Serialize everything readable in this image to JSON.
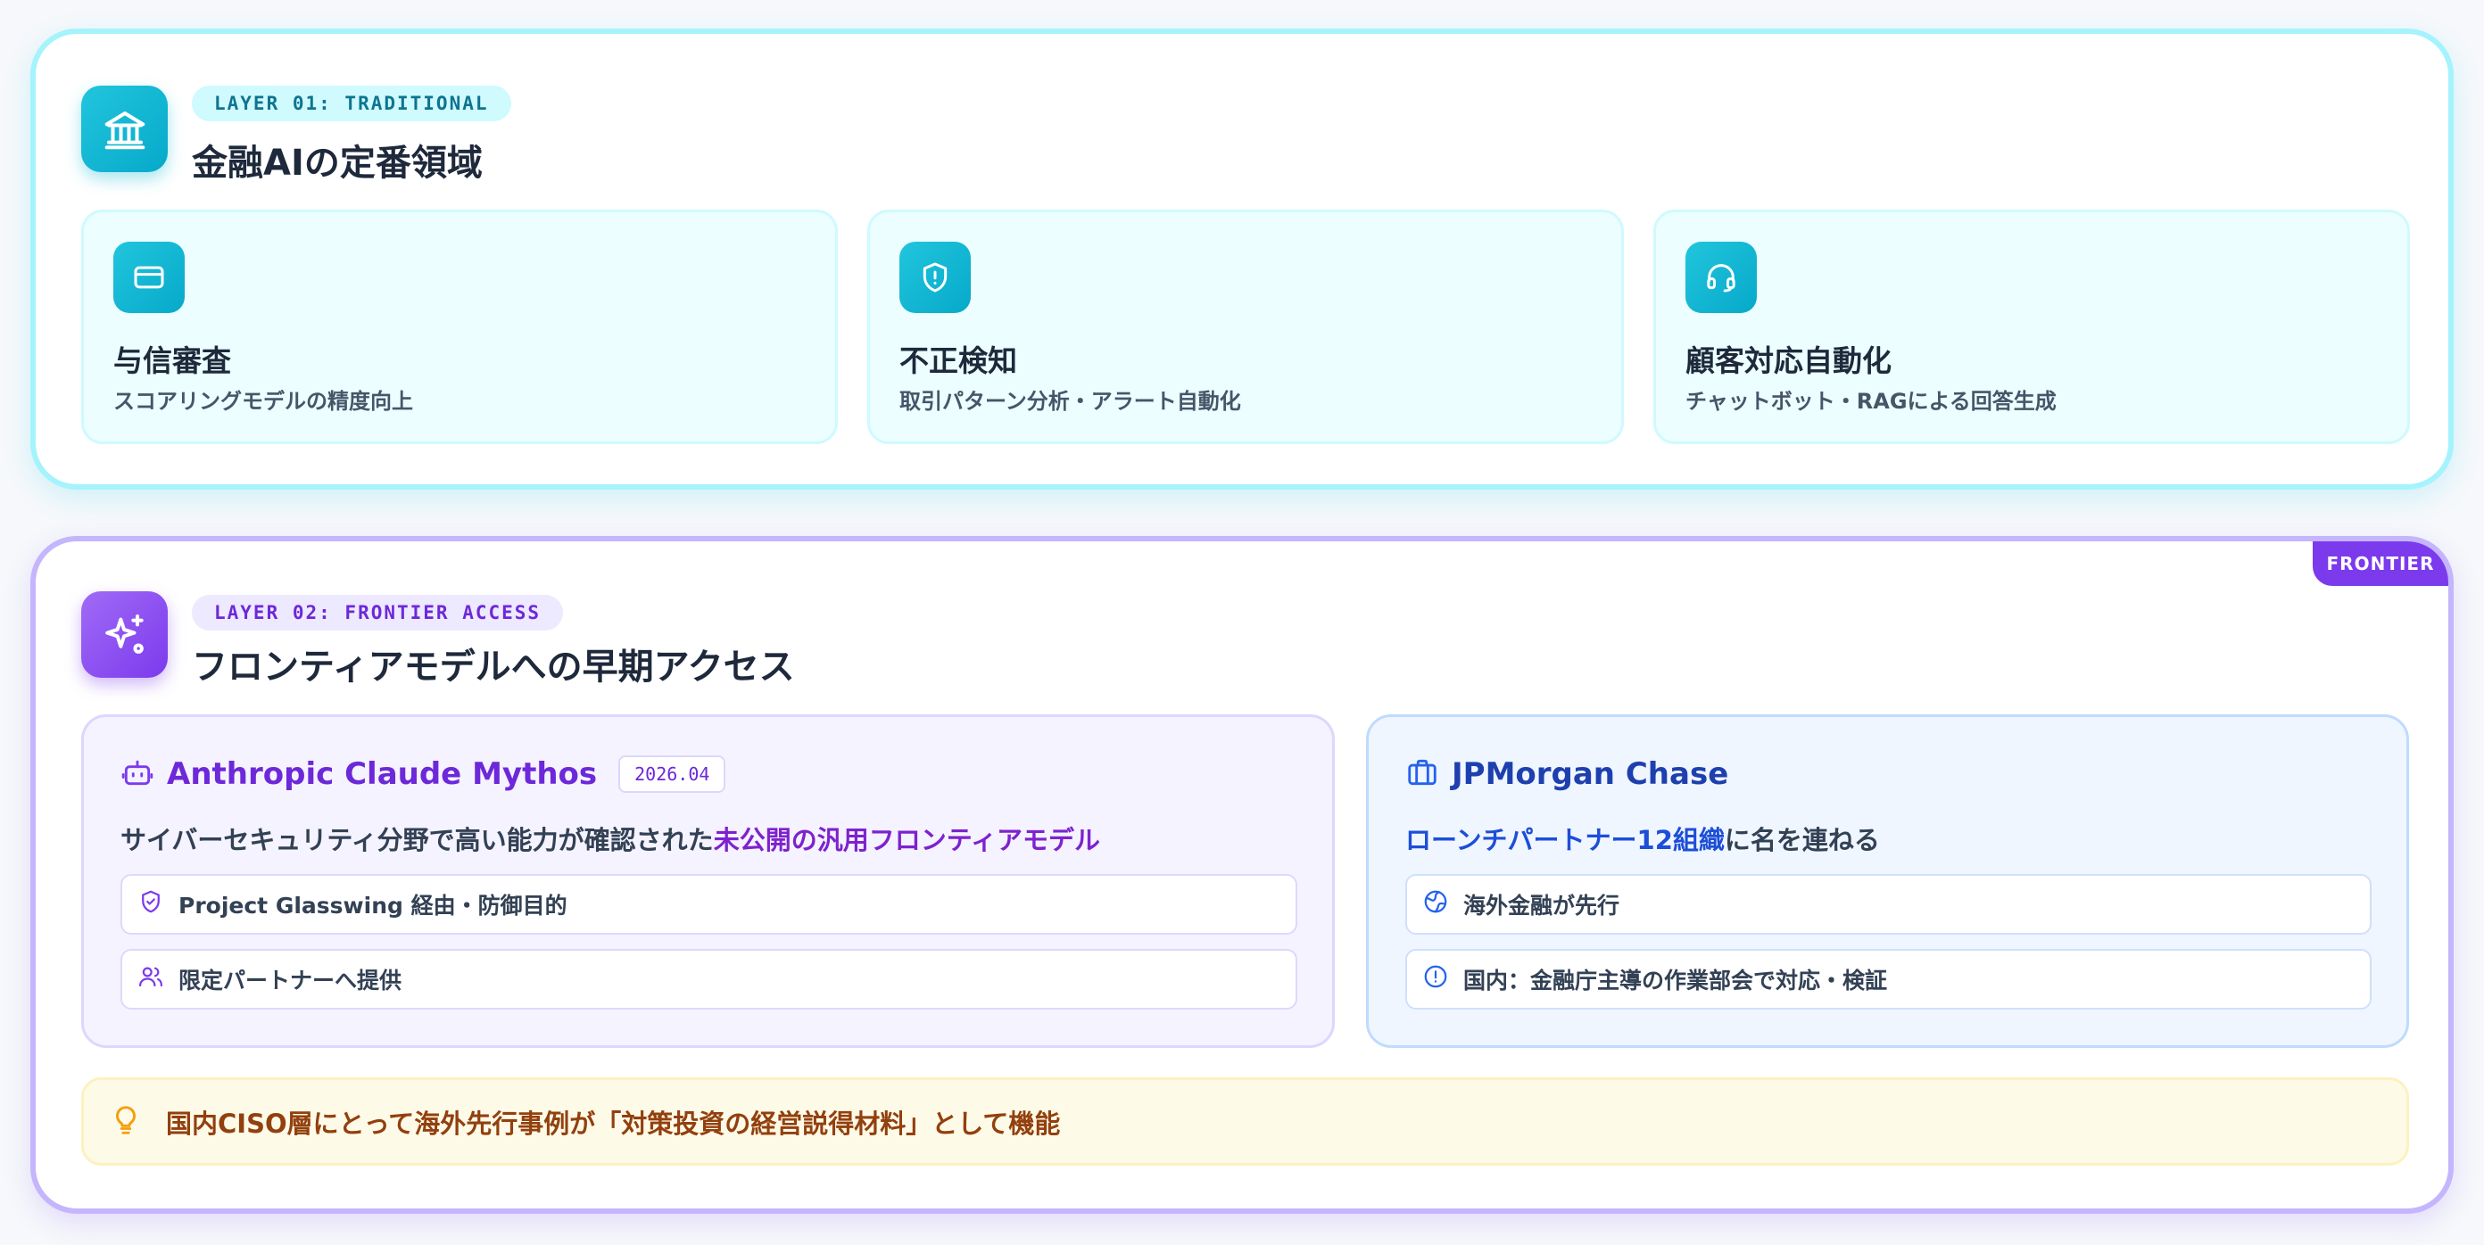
{
  "layer1": {
    "tag": "LAYER 01: TRADITIONAL",
    "title": "金融AIの定番領域",
    "icon": "bank-icon",
    "accent": "#06b6d4",
    "cards": [
      {
        "icon": "credit-card-icon",
        "title": "与信審査",
        "description": "スコアリングモデルの精度向上"
      },
      {
        "icon": "shield-alert-icon",
        "title": "不正検知",
        "description": "取引パターン分析・アラート自動化"
      },
      {
        "icon": "headset-icon",
        "title": "顧客対応自動化",
        "description": "チャットボット・RAGによる回答生成"
      }
    ]
  },
  "layer2": {
    "tag": "LAYER 02: FRONTIER ACCESS",
    "title": "フロンティアモデルへの早期アクセス",
    "icon": "sparkles-icon",
    "badge": "FRONTIER",
    "accent": "#7c3aed",
    "mythos": {
      "icon": "bot-icon",
      "name": "Anthropic Claude Mythos",
      "date": "2026.04",
      "desc_prefix": "サイバーセキュリティ分野で高い能力が確認された",
      "desc_highlight": "未公開の汎用フロンティアモデル",
      "items": [
        {
          "icon": "shield-check-icon",
          "text": "Project Glasswing 経由・防御目的"
        },
        {
          "icon": "users-icon",
          "text": "限定パートナーへ提供"
        }
      ]
    },
    "jpm": {
      "icon": "briefcase-icon",
      "name": "JPMorgan Chase",
      "desc_highlight": "ローンチパートナー12組織",
      "desc_suffix": "に名を連ねる",
      "items": [
        {
          "icon": "globe-icon",
          "text": "海外金融が先行"
        },
        {
          "icon": "alert-circle-icon",
          "text": "国内：金融庁主導の作業部会で対応・検証"
        }
      ]
    },
    "insight": {
      "icon": "lightbulb-icon",
      "text": "国内CISO層にとって海外先行事例が「対策投資の経営説得材料」として機能"
    }
  }
}
